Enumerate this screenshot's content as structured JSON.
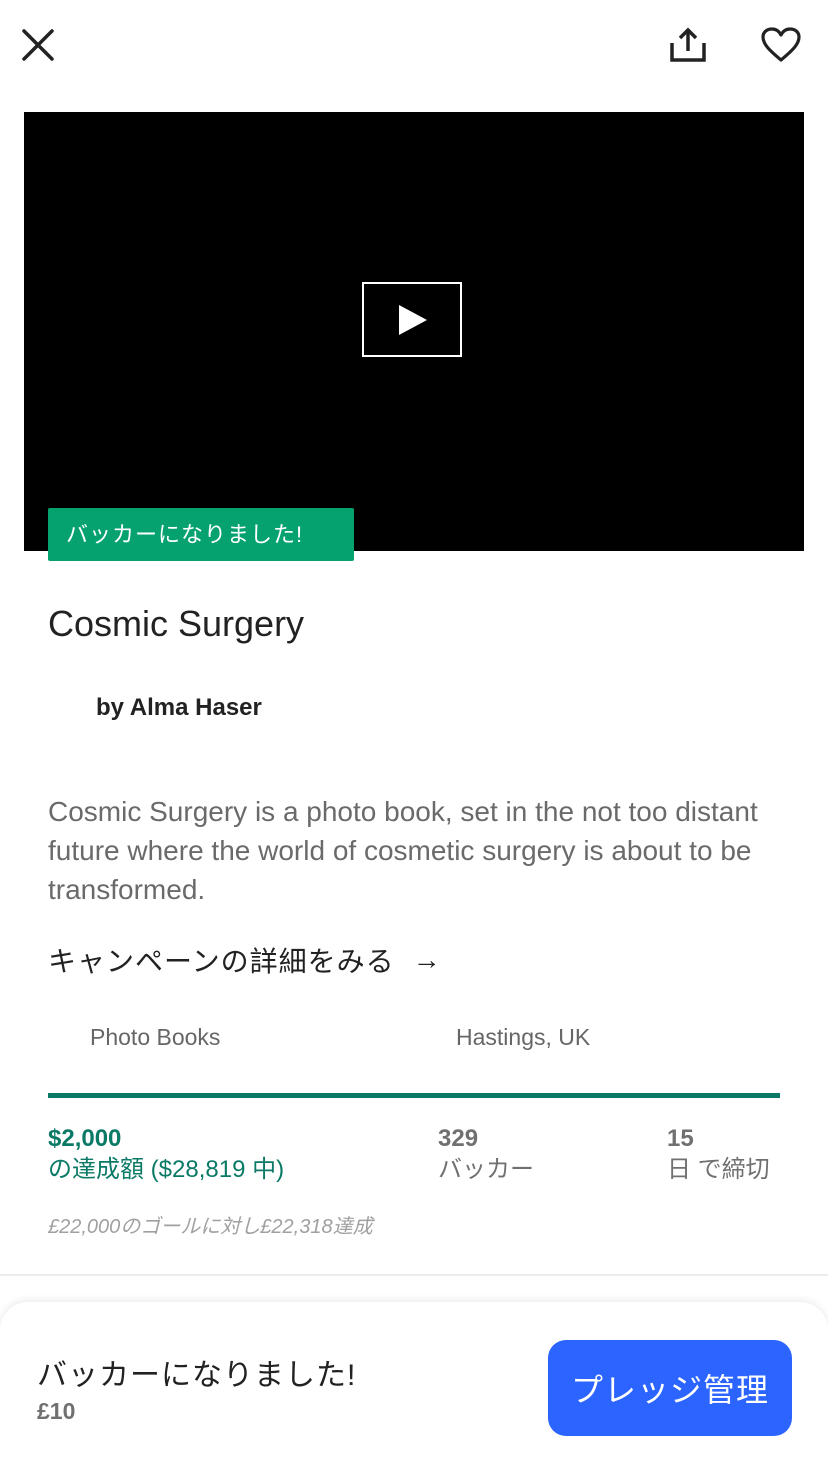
{
  "header": {
    "close_icon": "close-icon",
    "share_icon": "share-icon",
    "favorite_icon": "heart-icon"
  },
  "video": {
    "play_icon": "play-icon"
  },
  "badge": {
    "label": "バッカーになりました!"
  },
  "project": {
    "title": "Cosmic Surgery",
    "creator": "by Alma Haser",
    "description": "Cosmic Surgery is a photo book, set in the not too distant future where the world of cosmetic surgery is about to be transformed.",
    "campaign_link": "キャンペーンの詳細をみる",
    "campaign_arrow": "→",
    "category": "Photo Books",
    "location": "Hastings, UK"
  },
  "progress": {
    "funded_fraction": 1.0,
    "accent_color": "#0a7a66"
  },
  "stats": {
    "pledged_value": "$2,000",
    "pledged_label": "の達成額 ($28,819 中)",
    "backers_value": "329",
    "backers_label": "バッカー",
    "days_value": "15",
    "days_label": "日 で締切"
  },
  "goal_note": "£22,000のゴールに対し£22,318達成",
  "bottom_bar": {
    "title": "バッカーになりました!",
    "amount": "£10",
    "manage_button": "プレッジ管理",
    "button_color": "#2b64ff"
  }
}
